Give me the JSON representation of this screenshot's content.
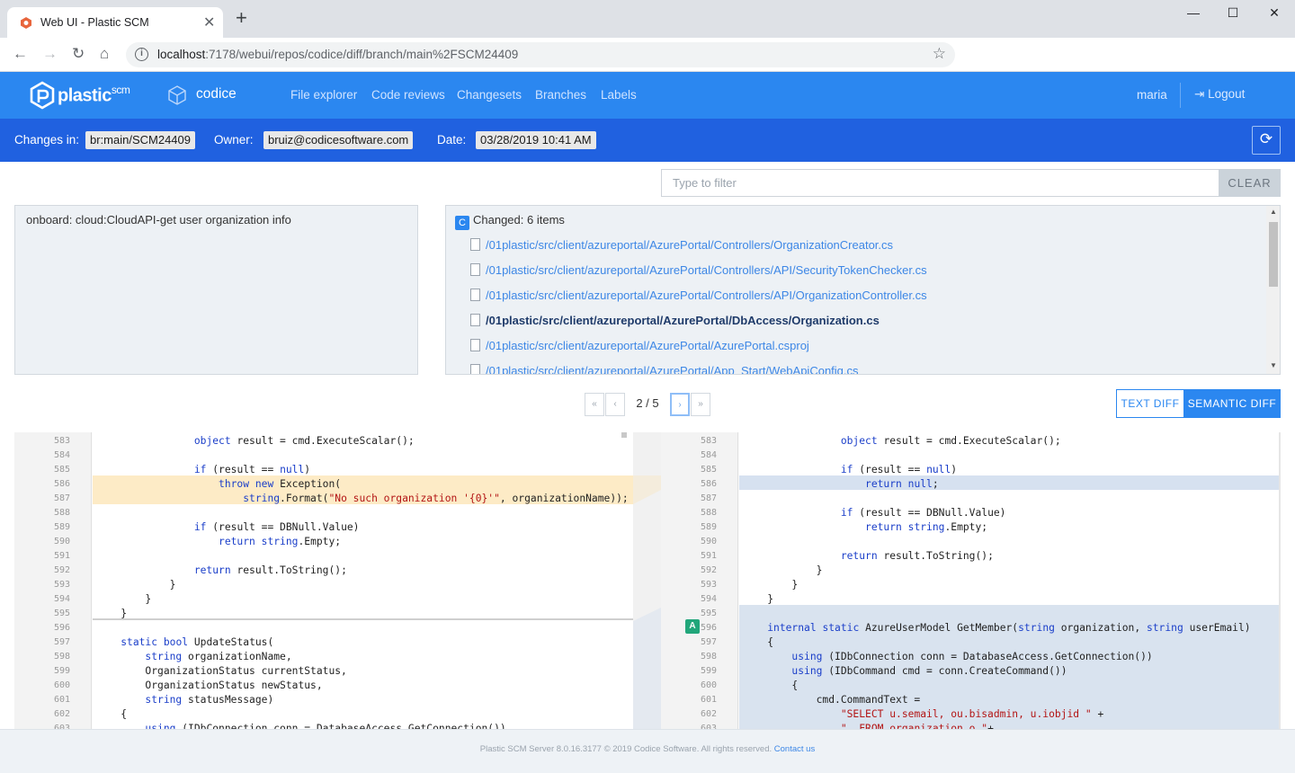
{
  "browser": {
    "tab_title": "Web UI - Plastic SCM",
    "url_host": "localhost",
    "url_path": ":7178/webui/repos/codice/diff/branch/main%2FSCM24409"
  },
  "app": {
    "logo_text": "plastic",
    "logo_sup": "scm",
    "repo_name": "codice",
    "nav": [
      "File explorer",
      "Code reviews",
      "Changesets",
      "Branches",
      "Labels"
    ],
    "user": "maria",
    "logout": "Logout"
  },
  "changes": {
    "changes_in_label": "Changes in:",
    "branch": "br:main/SCM24409",
    "owner_label": "Owner:",
    "owner": "bruiz@codicesoftware.com",
    "date_label": "Date:",
    "date": "03/28/2019 10:41 AM"
  },
  "filter": {
    "placeholder": "Type to filter",
    "clear": "CLEAR"
  },
  "comment": "onboard: cloud:CloudAPI-get user organization info",
  "items": {
    "badge": "C",
    "header": "Changed: 6 items",
    "files": [
      "/01plastic/src/client/azureportal/AzurePortal/Controllers/OrganizationCreator.cs",
      "/01plastic/src/client/azureportal/AzurePortal/Controllers/API/SecurityTokenChecker.cs",
      "/01plastic/src/client/azureportal/AzurePortal/Controllers/API/OrganizationController.cs",
      "/01plastic/src/client/azureportal/AzurePortal/DbAccess/Organization.cs",
      "/01plastic/src/client/azureportal/AzurePortal/AzurePortal.csproj",
      "/01plastic/src/client/azureportal/AzurePortal/App_Start/WebApiConfig.cs"
    ]
  },
  "pager": {
    "first": "«",
    "prev": "‹",
    "position": "2 / 5",
    "next": "›",
    "last": "»"
  },
  "diff_modes": {
    "text": "TEXT DIFF",
    "semantic": "SEMANTIC DIFF"
  },
  "left_diff": {
    "lines": [
      {
        "n": "583",
        "code": "                object result = cmd.ExecuteScalar();"
      },
      {
        "n": "584",
        "code": ""
      },
      {
        "n": "585",
        "code": "                if (result == null)"
      },
      {
        "n": "586",
        "code": "                    throw new Exception("
      },
      {
        "n": "587",
        "code": "                        string.Format(\"No such organization '{0}'\", organizationName));"
      },
      {
        "n": "588",
        "code": ""
      },
      {
        "n": "589",
        "code": "                if (result == DBNull.Value)"
      },
      {
        "n": "590",
        "code": "                    return string.Empty;"
      },
      {
        "n": "591",
        "code": ""
      },
      {
        "n": "592",
        "code": "                return result.ToString();"
      },
      {
        "n": "593",
        "code": "            }"
      },
      {
        "n": "594",
        "code": "        }"
      },
      {
        "n": "595",
        "code": "    }"
      },
      {
        "n": "596",
        "code": ""
      },
      {
        "n": "597",
        "code": "    static bool UpdateStatus("
      },
      {
        "n": "598",
        "code": "        string organizationName,"
      },
      {
        "n": "599",
        "code": "        OrganizationStatus currentStatus,"
      },
      {
        "n": "600",
        "code": "        OrganizationStatus newStatus,"
      },
      {
        "n": "601",
        "code": "        string statusMessage)"
      },
      {
        "n": "602",
        "code": "    {"
      },
      {
        "n": "603",
        "code": "        using (IDbConnection conn = DatabaseAccess.GetConnection())"
      }
    ]
  },
  "right_diff": {
    "added_badge": "A",
    "lines": [
      {
        "n": "583",
        "code": "                object result = cmd.ExecuteScalar();"
      },
      {
        "n": "584",
        "code": ""
      },
      {
        "n": "585",
        "code": "                if (result == null)"
      },
      {
        "n": "586",
        "code": "                    return null;"
      },
      {
        "n": "587",
        "code": ""
      },
      {
        "n": "588",
        "code": "                if (result == DBNull.Value)"
      },
      {
        "n": "589",
        "code": "                    return string.Empty;"
      },
      {
        "n": "590",
        "code": ""
      },
      {
        "n": "591",
        "code": "                return result.ToString();"
      },
      {
        "n": "592",
        "code": "            }"
      },
      {
        "n": "593",
        "code": "        }"
      },
      {
        "n": "594",
        "code": "    }"
      },
      {
        "n": "595",
        "code": ""
      },
      {
        "n": "596",
        "code": "    internal static AzureUserModel GetMember(string organization, string userEmail)"
      },
      {
        "n": "597",
        "code": "    {"
      },
      {
        "n": "598",
        "code": "        using (IDbConnection conn = DatabaseAccess.GetConnection())"
      },
      {
        "n": "599",
        "code": "        using (IDbCommand cmd = conn.CreateCommand())"
      },
      {
        "n": "600",
        "code": "        {"
      },
      {
        "n": "601",
        "code": "            cmd.CommandText ="
      },
      {
        "n": "602",
        "code": "                \"SELECT u.semail, ou.bisadmin, u.iobjid \" +"
      },
      {
        "n": "603",
        "code": "                \"  FROM organization o \"+"
      }
    ]
  },
  "footer": {
    "text": "Plastic SCM Server 8.0.16.3177 © 2019 Codice Software. All rights reserved.",
    "link": "Contact us"
  },
  "colors": {
    "nav_blue": "#2b87f0",
    "changes_bar": "#2061e0",
    "removed_highlight": "#fdebc6",
    "changed_highlight": "#d6e1f0",
    "added_badge": "#21a67a"
  }
}
